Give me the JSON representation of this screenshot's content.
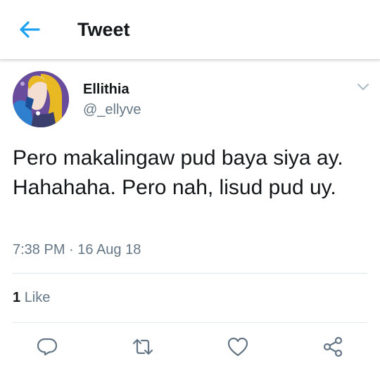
{
  "header": {
    "title": "Tweet"
  },
  "tweet": {
    "display_name": "Ellithia",
    "handle": "@_ellyve",
    "text": "Pero makalingaw pud baya siya ay. Hahahaha. Pero nah, lisud pud uy.",
    "timestamp": "7:38 PM · 16 Aug 18",
    "like_count": "1",
    "like_label": "Like"
  },
  "icons": {
    "back": "arrow-left-icon",
    "menu": "chevron-down-icon",
    "reply": "reply-icon",
    "retweet": "retweet-icon",
    "like": "heart-icon",
    "share": "share-icon"
  },
  "colors": {
    "accent": "#1da1f2",
    "secondary_text": "#657786",
    "icon": "#657786"
  }
}
